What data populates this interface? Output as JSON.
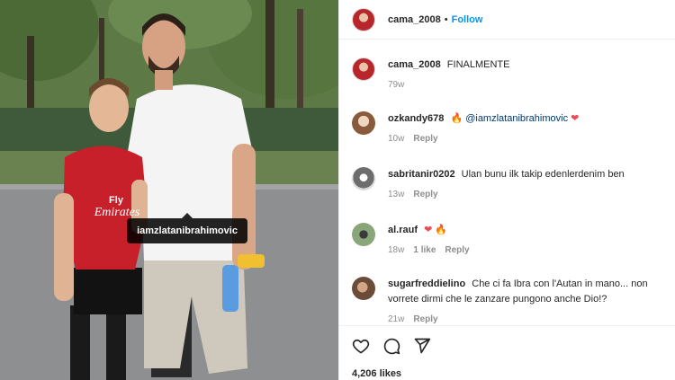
{
  "post": {
    "tag_label": "iamzlatanibrahimovic",
    "shirt_text": "Fly Emirates",
    "owner": {
      "username": "cama_2008",
      "follow_label": "Follow"
    },
    "caption": {
      "username": "cama_2008",
      "text": "FINALMENTE",
      "time": "79w"
    },
    "comments": [
      {
        "username": "ozkandy678",
        "prefix_icon": "fire-emoji",
        "mention": "@iamzlatanibrahimovic",
        "suffix_icon": "red-heart-emoji",
        "time": "10w",
        "reply": "Reply"
      },
      {
        "username": "sabritanir0202",
        "text": "Ulan bunu ilk takip edenlerdenim ben",
        "time": "13w",
        "reply": "Reply"
      },
      {
        "username": "al.rauf",
        "icons": [
          "red-heart-emoji",
          "fire-emoji"
        ],
        "time": "18w",
        "likes": "1 like",
        "reply": "Reply"
      },
      {
        "username": "sugarfreddielino",
        "text": "Che ci fa Ibra con l'Autan in mano... non vorrete dirmi che le zanzare pungono anche Dio!?",
        "time": "21w",
        "reply": "Reply"
      }
    ],
    "likes_count": "4,206 likes",
    "colors": {
      "follow": "#0095f6",
      "mention": "#00376b",
      "heart": "#ed4956"
    }
  }
}
